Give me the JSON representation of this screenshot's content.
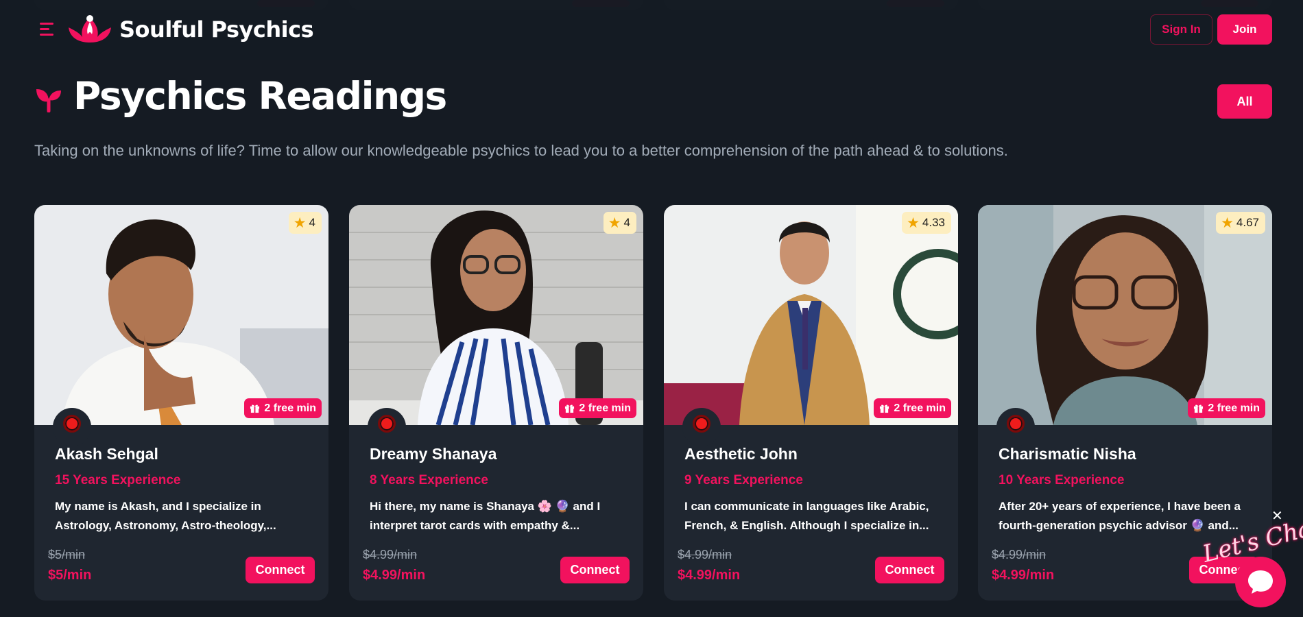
{
  "header": {
    "brand": "Soulful Psychics",
    "sign_in_label": "Sign In",
    "join_label": "Join"
  },
  "section": {
    "title": "Psychics Readings",
    "all_label": "All",
    "subtitle": "Taking on the unknowns of life? Time to allow our knowledgeable psychics to lead you to a better comprehension of the path ahead & to solutions."
  },
  "cards": [
    {
      "rating": "4",
      "free_min": "2 free min",
      "name": "Akash Sehgal",
      "experience": "15 Years Experience",
      "description": "My name is Akash, and I specialize in Astrology, Astronomy, Astro-theology,...",
      "old_price": "$5/min",
      "price": "$5/min",
      "connect_label": "Connect"
    },
    {
      "rating": "4",
      "free_min": "2 free min",
      "name": "Dreamy Shanaya",
      "experience": "8 Years Experience",
      "description": "Hi there, my name is Shanaya 🌸 🔮 and I interpret tarot cards with empathy &...",
      "old_price": "$4.99/min",
      "price": "$4.99/min",
      "connect_label": "Connect"
    },
    {
      "rating": "4.33",
      "free_min": "2 free min",
      "name": "Aesthetic John",
      "experience": "9 Years Experience",
      "description": "I can communicate in languages like Arabic, French, & English. Although I specialize in...",
      "old_price": "$4.99/min",
      "price": "$4.99/min",
      "connect_label": "Connect"
    },
    {
      "rating": "4.67",
      "free_min": "2 free min",
      "name": "Charismatic Nisha",
      "experience": "10 Years Experience",
      "description": "After 20+ years of experience, I have been a fourth-generation psychic advisor 🔮 and...",
      "old_price": "$4.99/min",
      "price": "$4.99/min",
      "connect_label": "Connect"
    }
  ],
  "chat": {
    "script_text": "Let's Chat",
    "close_glyph": "✕"
  },
  "colors": {
    "accent": "#f2125e",
    "background": "#151b23",
    "card": "#1f2630"
  }
}
